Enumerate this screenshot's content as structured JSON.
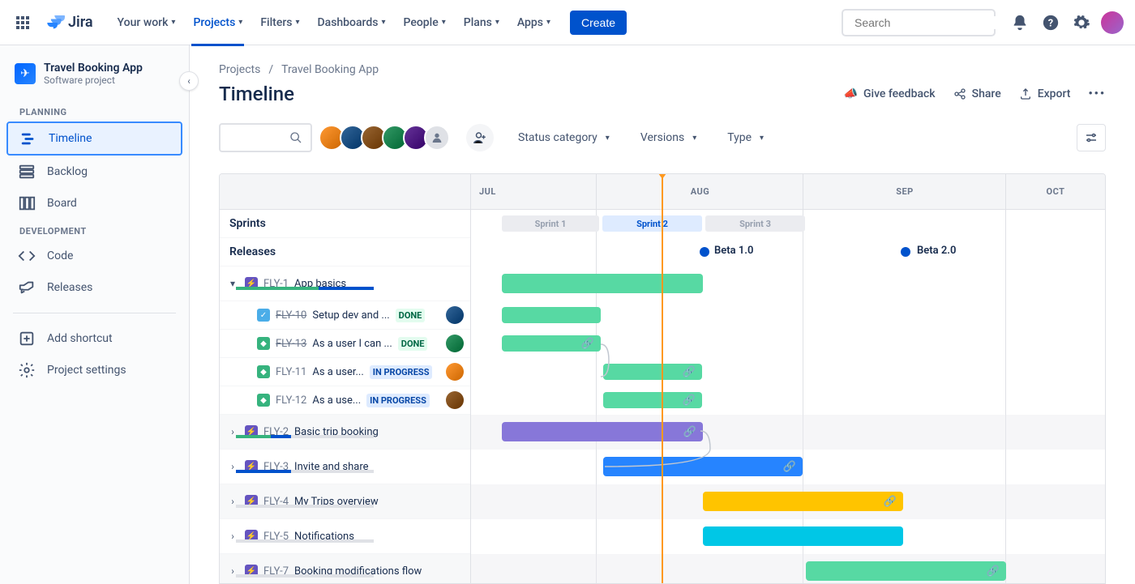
{
  "logo_text": "Jira",
  "nav": {
    "your_work": "Your work",
    "projects": "Projects",
    "filters": "Filters",
    "dashboards": "Dashboards",
    "people": "People",
    "plans": "Plans",
    "apps": "Apps",
    "create": "Create"
  },
  "search_placeholder": "Search",
  "sidebar": {
    "project_name": "Travel Booking App",
    "project_type": "Software project",
    "section_planning": "PLANNING",
    "section_development": "DEVELOPMENT",
    "timeline": "Timeline",
    "backlog": "Backlog",
    "board": "Board",
    "code": "Code",
    "releases": "Releases",
    "add_shortcut": "Add shortcut",
    "project_settings": "Project settings"
  },
  "breadcrumbs": {
    "projects": "Projects",
    "project": "Travel Booking App"
  },
  "page_title": "Timeline",
  "header": {
    "feedback": "Give feedback",
    "share": "Share",
    "export": "Export"
  },
  "filters": {
    "status_category": "Status category",
    "versions": "Versions",
    "type": "Type"
  },
  "timeline": {
    "months": [
      "JUL",
      "AUG",
      "SEP",
      "OCT"
    ],
    "sprints_label": "Sprints",
    "releases_label": "Releases",
    "sprints": [
      {
        "name": "Sprint 1",
        "state": "past"
      },
      {
        "name": "Sprint 2",
        "state": "current"
      },
      {
        "name": "Sprint 3",
        "state": "past"
      }
    ],
    "releases": [
      {
        "name": "Beta 1.0"
      },
      {
        "name": "Beta 2.0"
      }
    ],
    "epics": [
      {
        "key": "FLY-1",
        "summary": "App basics",
        "expanded": true,
        "bar_color": "green",
        "children": [
          {
            "key": "FLY-10",
            "summary": "Setup dev and ...",
            "status": "DONE",
            "icon": "task"
          },
          {
            "key": "FLY-13",
            "summary": "As a user I can ...",
            "status": "DONE",
            "icon": "story"
          },
          {
            "key": "FLY-11",
            "summary": "As a user...",
            "status": "IN PROGRESS",
            "icon": "story"
          },
          {
            "key": "FLY-12",
            "summary": "As a use...",
            "status": "IN PROGRESS",
            "icon": "story"
          }
        ]
      },
      {
        "key": "FLY-2",
        "summary": "Basic trip booking",
        "bar_color": "purple"
      },
      {
        "key": "FLY-3",
        "summary": "Invite and share",
        "bar_color": "blue"
      },
      {
        "key": "FLY-4",
        "summary": "My Trips overview",
        "bar_color": "yellow"
      },
      {
        "key": "FLY-5",
        "summary": "Notifications",
        "bar_color": "teal"
      },
      {
        "key": "FLY-7",
        "summary": "Booking modifications flow",
        "bar_color": "green"
      }
    ]
  }
}
